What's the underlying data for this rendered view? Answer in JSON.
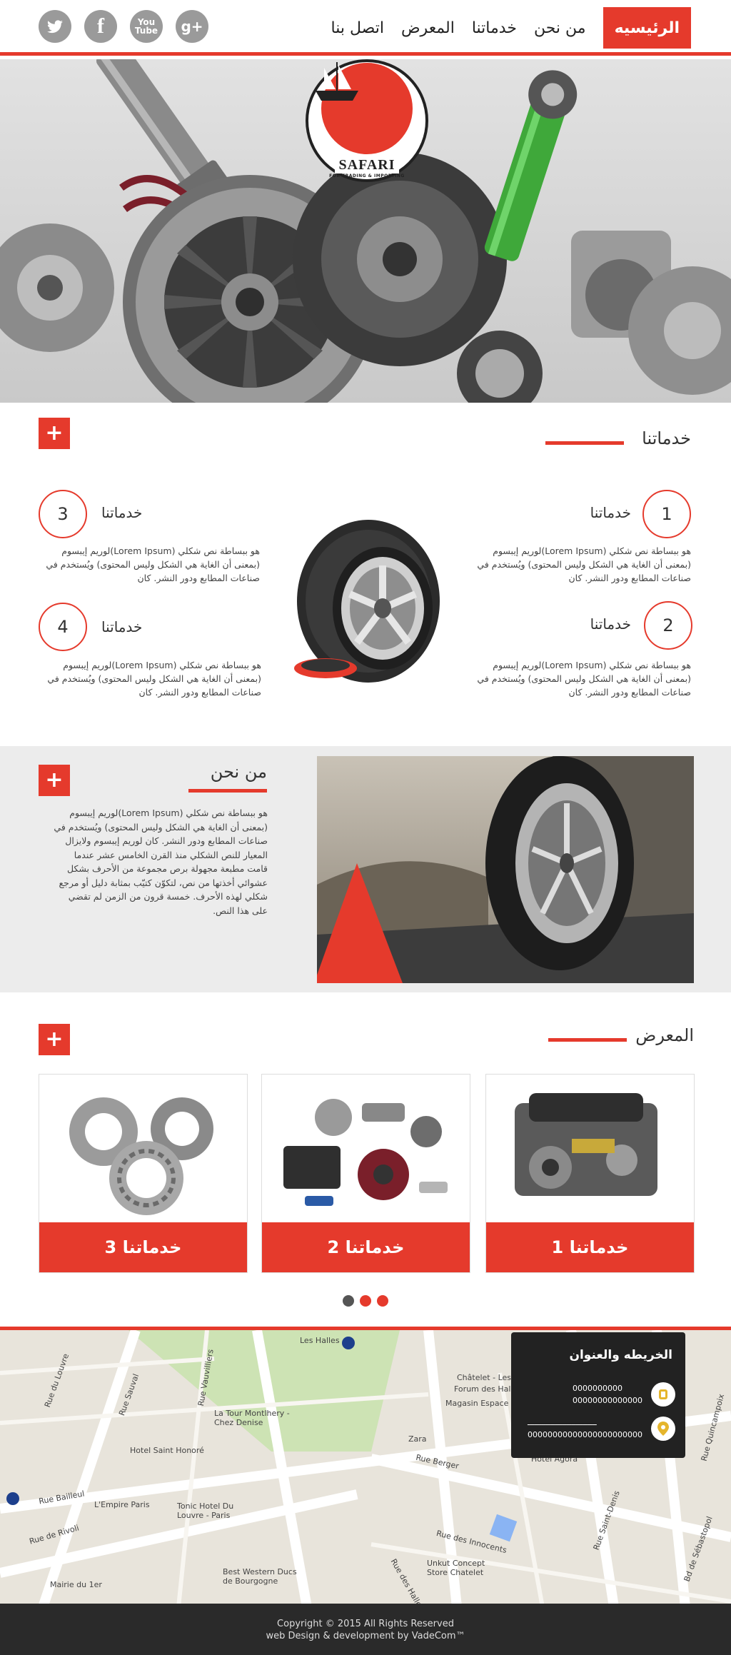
{
  "header": {
    "socials": [
      {
        "name": "twitter-icon",
        "label": ""
      },
      {
        "name": "facebook-icon",
        "label": "f"
      },
      {
        "name": "youtube-icon",
        "label": "You Tube"
      },
      {
        "name": "google-plus-icon",
        "label": "g+"
      }
    ],
    "nav": [
      "الرئيسيه",
      "من نحن",
      "خدماتنا",
      "المعرض",
      "اتصل بنا"
    ],
    "active_index": 0
  },
  "hero": {
    "logo_text": "SAFARI",
    "logo_sub": "FOR TRADING & IMPORTING"
  },
  "services": {
    "title": "خدماتنا",
    "plus": "+",
    "items": [
      {
        "num": "1",
        "title": "خدماتنا",
        "text": "هو ببساطة نص شكلي (Lorem Ipsum)لوريم إيبسوم (بمعنى أن الغاية هي الشكل وليس المحتوى) ويُستخدم في صناعات المطابع ودور النشر. كان"
      },
      {
        "num": "2",
        "title": "خدماتنا",
        "text": "هو ببساطة نص شكلي (Lorem Ipsum)لوريم إيبسوم (بمعنى أن الغاية هي الشكل وليس المحتوى) ويُستخدم في صناعات المطابع ودور النشر. كان"
      },
      {
        "num": "3",
        "title": "خدماتنا",
        "text": "هو ببساطة نص شكلي (Lorem Ipsum)لوريم إيبسوم (بمعنى أن الغاية هي الشكل وليس المحتوى) ويُستخدم في صناعات المطابع ودور النشر. كان"
      },
      {
        "num": "4",
        "title": "خدماتنا",
        "text": "هو ببساطة نص شكلي (Lorem Ipsum)لوريم إيبسوم (بمعنى أن الغاية هي الشكل وليس المحتوى) ويُستخدم في صناعات المطابع ودور النشر. كان"
      }
    ]
  },
  "about": {
    "title": "من نحن",
    "plus": "+",
    "text": "هو ببساطة نص شكلي (Lorem Ipsum)لوريم إيبسوم (بمعنى أن الغاية هي الشكل وليس المحتوى) ويُستخدم في صناعات المطابع ودور النشر. كان لوريم إيبسوم ولايزال المعيار للنص الشكلي منذ القرن الخامس عشر عندما قامت مطبعة مجهولة برص مجموعة من الأحرف بشكل عشوائي أخذتها من نص، لتكوّن كتيّب بمثابة دليل أو مرجع شكلي لهذه الأحرف. خمسة قرون من الزمن لم تقضي على هذا النص."
  },
  "gallery": {
    "title": "المعرض",
    "plus": "+",
    "cards": [
      "خدماتنا 1",
      "خدماتنا 2",
      "خدماتنا 3"
    ],
    "dots": [
      "#555555",
      "#e53a2c",
      "#e53a2c"
    ]
  },
  "map": {
    "labels": [
      "Les Halles",
      "Châtelet - Les Halles",
      "Forum des Halles",
      "Magasin Espace S",
      "La Tour Montlhery - Chez Denise",
      "Hotel Saint Honoré",
      "Zara",
      "Rue Berger",
      "Hotel Agora",
      "Rue Bailleul",
      "L'Empire Paris",
      "Tonic Hotel Du Louvre - Paris",
      "Rue du Louvre",
      "Rue Sauval",
      "Rue des Innocents",
      "Unkut Concept Store Chatelet",
      "Rue de Rivoli",
      "Best Western Ducs de Bourgogne",
      "Mairie du 1er",
      "Rue Saint-Denis",
      "Bd de Sébastopol",
      "Rue Quincampoix",
      "Rue des Halles",
      "Rue Vauvilliers"
    ]
  },
  "contact": {
    "title": "الخريطه والعنوان",
    "phone_lines": [
      "0000000000",
      "00000000000000"
    ],
    "address_lines": [
      "ــــــــــــــــــــــــــــــ",
      "00000000000000000000000"
    ]
  },
  "footer": {
    "line1": "Copyright © 2015 All Rights Reserved",
    "line2": "web Design & development by VadeCom™"
  },
  "colors": {
    "accent": "#e53a2c",
    "dark": "#222222",
    "footer": "#2a2a2a"
  }
}
